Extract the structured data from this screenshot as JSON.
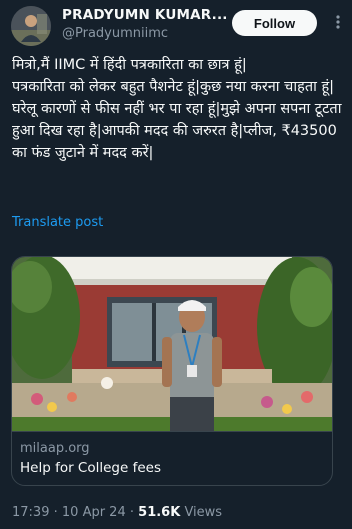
{
  "author": {
    "display_name": "PRADYUMN KUMAR...",
    "handle": "@Pradyumniimc",
    "avatar_icon": "user-avatar"
  },
  "header": {
    "follow_label": "Follow",
    "more_icon": "more-horizontal-icon"
  },
  "tweet": {
    "text": "मित्रो,मैं IIMC में हिंदी पत्रकारिता का छात्र हूं|\nपत्रकारिता को लेकर बहुत पैशनेट हूं|कुछ नया करना चाहता हूं|घरेलू कारणों से फीस नहीं भर पा रहा हूं|मुझे अपना सपना टूटता हुआ दिख रहा है|आपकी मदद की जरुरत है|प्लीज, ₹43500 का फंड जुटाने में मदद करें|",
    "translate_label": "Translate post"
  },
  "link_card": {
    "image_alt": "Young man in grey t-shirt standing in front of building entrance with plants",
    "domain": "milaap.org",
    "title": "Help for College fees"
  },
  "meta": {
    "time": "17:39",
    "separator": "·",
    "date": "10 Apr 24",
    "views_count": "51.6K",
    "views_label": "Views"
  },
  "colors": {
    "background": "#15202b",
    "text": "#f7f9f9",
    "secondary": "#8b98a5",
    "link": "#1d9bf0",
    "border": "#38444d"
  }
}
